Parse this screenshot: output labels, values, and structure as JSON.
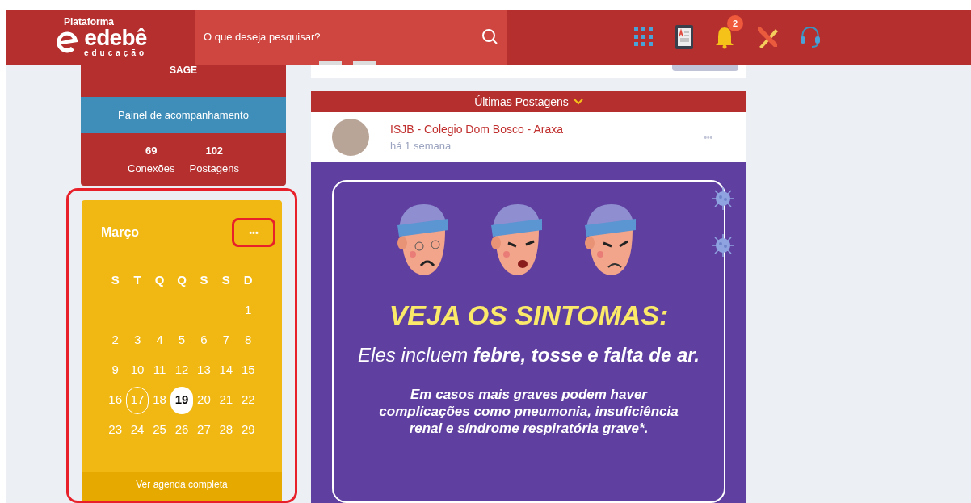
{
  "header": {
    "logo": {
      "top": "Plataforma",
      "brand": "edebê",
      "sub": "educação"
    },
    "search": {
      "placeholder": "O que deseja pesquisar?"
    },
    "notification_badge": "2"
  },
  "profile": {
    "name": "SAGE",
    "panel_button": "Painel de acompanhamento",
    "stats": [
      {
        "value": "69",
        "label": "Conexões"
      },
      {
        "value": "102",
        "label": "Postagens"
      }
    ]
  },
  "calendar": {
    "highlighted": true,
    "month": "Março",
    "more_button": {
      "label": "•••",
      "highlighted": true
    },
    "weekdays": [
      "S",
      "T",
      "Q",
      "Q",
      "S",
      "S",
      "D"
    ],
    "weeks": [
      [
        {
          "day": "1",
          "selected": false,
          "outlined": false
        }
      ],
      [
        {
          "day": "2",
          "selected": false,
          "outlined": false
        },
        {
          "day": "3",
          "selected": false,
          "outlined": false
        },
        {
          "day": "4",
          "selected": false,
          "outlined": false
        },
        {
          "day": "5",
          "selected": false,
          "outlined": false
        },
        {
          "day": "6",
          "selected": false,
          "outlined": false
        },
        {
          "day": "7",
          "selected": false,
          "outlined": false
        },
        {
          "day": "8",
          "selected": false,
          "outlined": false
        }
      ],
      [
        {
          "day": "9",
          "selected": false,
          "outlined": false
        },
        {
          "day": "10",
          "selected": false,
          "outlined": false
        },
        {
          "day": "11",
          "selected": false,
          "outlined": false
        },
        {
          "day": "12",
          "selected": false,
          "outlined": false
        },
        {
          "day": "13",
          "selected": false,
          "outlined": false
        },
        {
          "day": "14",
          "selected": false,
          "outlined": false
        },
        {
          "day": "15",
          "selected": false,
          "outlined": false
        }
      ],
      [
        {
          "day": "16",
          "selected": false,
          "outlined": false
        },
        {
          "day": "17",
          "selected": false,
          "outlined": true
        },
        {
          "day": "18",
          "selected": false,
          "outlined": false
        },
        {
          "day": "19",
          "selected": true,
          "outlined": false
        },
        {
          "day": "20",
          "selected": false,
          "outlined": false
        },
        {
          "day": "21",
          "selected": false,
          "outlined": false
        },
        {
          "day": "22",
          "selected": false,
          "outlined": false
        }
      ],
      [
        {
          "day": "23",
          "selected": false,
          "outlined": false
        },
        {
          "day": "24",
          "selected": false,
          "outlined": false
        },
        {
          "day": "25",
          "selected": false,
          "outlined": false
        },
        {
          "day": "26",
          "selected": false,
          "outlined": false
        },
        {
          "day": "27",
          "selected": false,
          "outlined": false
        },
        {
          "day": "28",
          "selected": false,
          "outlined": false
        },
        {
          "day": "29",
          "selected": false,
          "outlined": false
        }
      ]
    ],
    "footer_link": "Ver agenda completa"
  },
  "feed": {
    "title": "Últimas Postagens",
    "post": {
      "author": "ISJB - Colegio Dom Bosco - Araxa",
      "time": "há 1 semana",
      "more": "•••",
      "image": {
        "headline": "VEJA OS SINTOMAS:",
        "subline": "Eles incluem **febre, tosse e falta de ar.**",
        "body": "Em casos mais graves podem haver complicações como pneumonia, insuficiência renal e síndrome respiratória grave*."
      }
    }
  }
}
